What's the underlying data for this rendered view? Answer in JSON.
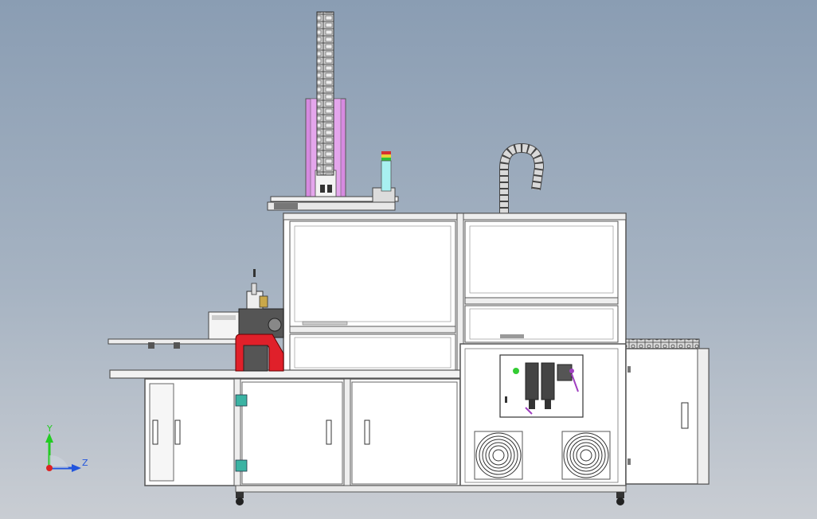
{
  "viewport": {
    "background_top": "#8a9db3",
    "background_bottom": "#c9cdd3",
    "model_line_color": "#555555",
    "panel_fill": "#ffffff"
  },
  "axis_triad": {
    "y_label": "Y",
    "z_label": "Z",
    "y_color": "#22cc22",
    "z_color": "#2255dd",
    "origin_color": "#dd2222"
  },
  "accent_colors": {
    "gantry_column": "#d68ae0",
    "robot_red": "#e0202a",
    "stack_light_green": "#2fbf3a",
    "stack_light_yellow": "#e8d23a",
    "stack_light_red": "#d63030",
    "stack_light_cyan": "#a8f0f0",
    "hinge_teal": "#3bb3a3",
    "regulator_green": "#33cc33",
    "regulator_purple": "#a040c0"
  },
  "components": [
    "gantry-column",
    "drag-chain-vertical",
    "drag-chain-hook",
    "drag-chain-horizontal",
    "stack-light",
    "main-cabinet",
    "side-cabinet",
    "conveyor-rail",
    "robot-module",
    "air-prep-unit",
    "fan-left",
    "fan-right",
    "caster-left",
    "caster-right"
  ]
}
